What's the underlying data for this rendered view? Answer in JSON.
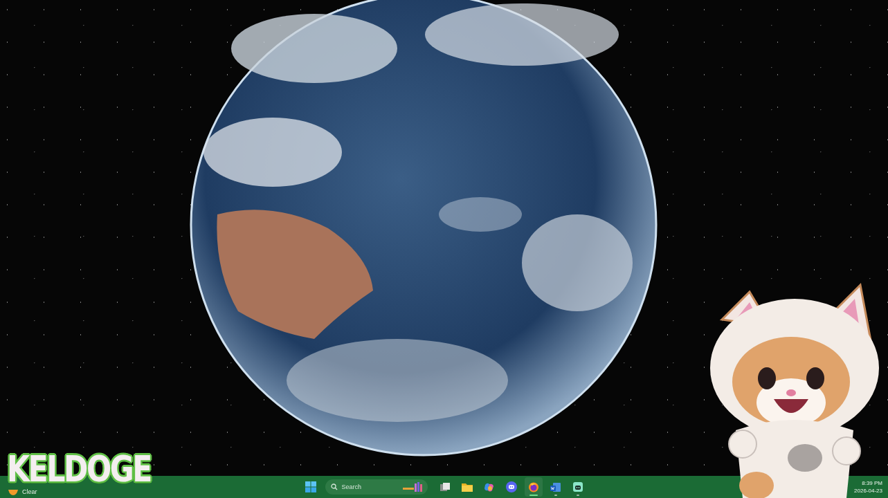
{
  "overlay": {
    "logo": "KELDOGE"
  },
  "taskbar": {
    "weather": {
      "condition": "Clear"
    },
    "search": {
      "placeholder": "Search"
    },
    "apps": [
      {
        "kind": "task-view",
        "running": false,
        "selected": false
      },
      {
        "kind": "folder",
        "running": false,
        "selected": false
      },
      {
        "kind": "copilot",
        "running": false,
        "selected": false
      },
      {
        "kind": "chat",
        "running": false,
        "selected": false
      },
      {
        "kind": "browser",
        "running": true,
        "selected": true
      },
      {
        "kind": "word",
        "running": true,
        "selected": false
      },
      {
        "kind": "robot",
        "running": true,
        "selected": false
      }
    ],
    "clock": {
      "time": "8:39 PM",
      "date": "2026-04-23"
    }
  }
}
